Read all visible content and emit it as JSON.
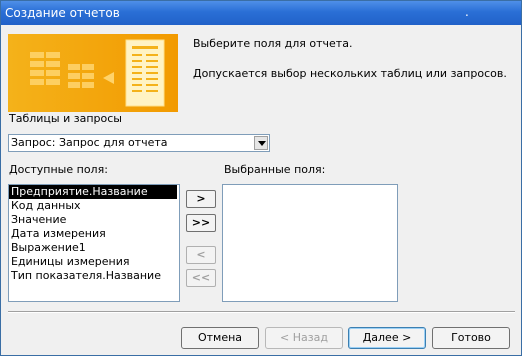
{
  "window": {
    "title": "Создание отчетов",
    "title_dot": "."
  },
  "intro": {
    "message1": "Выберите поля для отчета.",
    "message2": "Допускается выбор нескольких таблиц или запросов."
  },
  "tables": {
    "label": "Таблицы и запросы",
    "selected": "Запрос: Запрос для отчета"
  },
  "available_fields": {
    "label": "Доступные поля:",
    "items": [
      "Предприятие.Название",
      "Код данных",
      "Значение",
      "Дата измерения",
      "Выражение1",
      "Единицы измерения",
      "Тип показателя.Название"
    ],
    "selected_index": 0
  },
  "selected_fields": {
    "label": "Выбранные поля:",
    "items": []
  },
  "move_buttons": {
    "add_one": ">",
    "add_all": ">>",
    "remove_one": "<",
    "remove_all": "<<"
  },
  "footer": {
    "cancel": "Отмена",
    "back": "< Назад",
    "next": "Далее >",
    "finish": "Готово"
  },
  "colors": {
    "titlebar": "#2a6fd6",
    "selection": "#000000"
  }
}
